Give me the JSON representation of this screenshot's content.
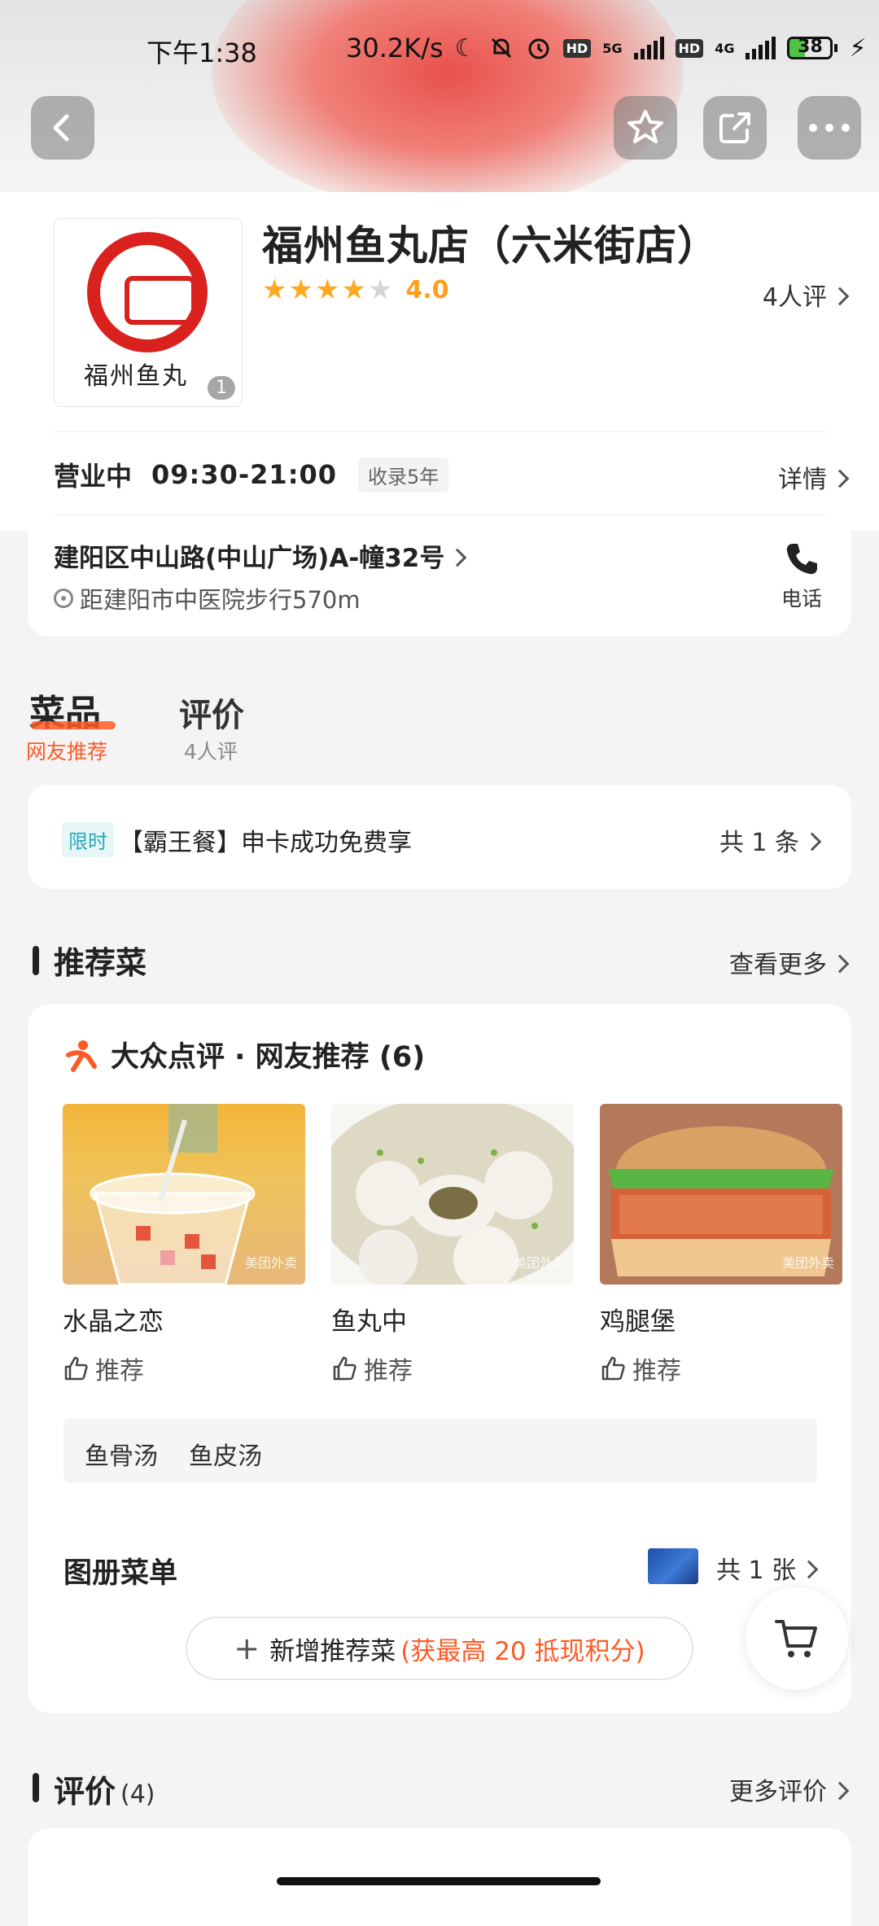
{
  "status_bar": {
    "time": "下午1:38",
    "net_speed": "30.2K/s",
    "sim1_label": "5G",
    "sim2_label": "4G",
    "hd_label": "HD",
    "battery": "38",
    "battery_level": 0.38
  },
  "store": {
    "name": "福州鱼丸店（六米街店）",
    "logo_text": "福州鱼丸",
    "photo_count": "1",
    "rating_value": 4.0,
    "rating_label": "4.0",
    "review_link": "4人评",
    "open_status": "营业中",
    "hours": "09:30-21:00",
    "listed_tag": "收录5年",
    "details_link": "详情",
    "address": "建阳区中山路(中山广场)A-幢32号",
    "distance": "距建阳市中医院步行570m",
    "phone_label": "电话"
  },
  "tabs": [
    {
      "label": "菜品",
      "sub": "网友推荐"
    },
    {
      "label": "评价",
      "sub": "4人评"
    }
  ],
  "promo": {
    "badge": "限时",
    "text": "【霸王餐】申卡成功免费享",
    "count": "共 1 条"
  },
  "recommend": {
    "section_title": "推荐菜",
    "more": "查看更多",
    "card_title": "大众点评 · 网友推荐 (6)",
    "watermark": "美团外卖",
    "dishes": [
      {
        "name": "水晶之恋",
        "action": "推荐"
      },
      {
        "name": "鱼丸中",
        "action": "推荐"
      },
      {
        "name": "鸡腿堡",
        "action": "推荐"
      }
    ],
    "tags": [
      "鱼骨汤",
      "鱼皮汤"
    ],
    "album_title": "图册菜单",
    "album_count": "共 1 张",
    "add_label": "新增推荐菜",
    "add_bonus": "(获最高 20 抵现积分)"
  },
  "reviews": {
    "title": "评价",
    "count": "(4)",
    "more": "更多评价"
  },
  "colors": {
    "accent": "#ff5a26",
    "star": "#ffa823",
    "brand_red": "#d9211e"
  }
}
